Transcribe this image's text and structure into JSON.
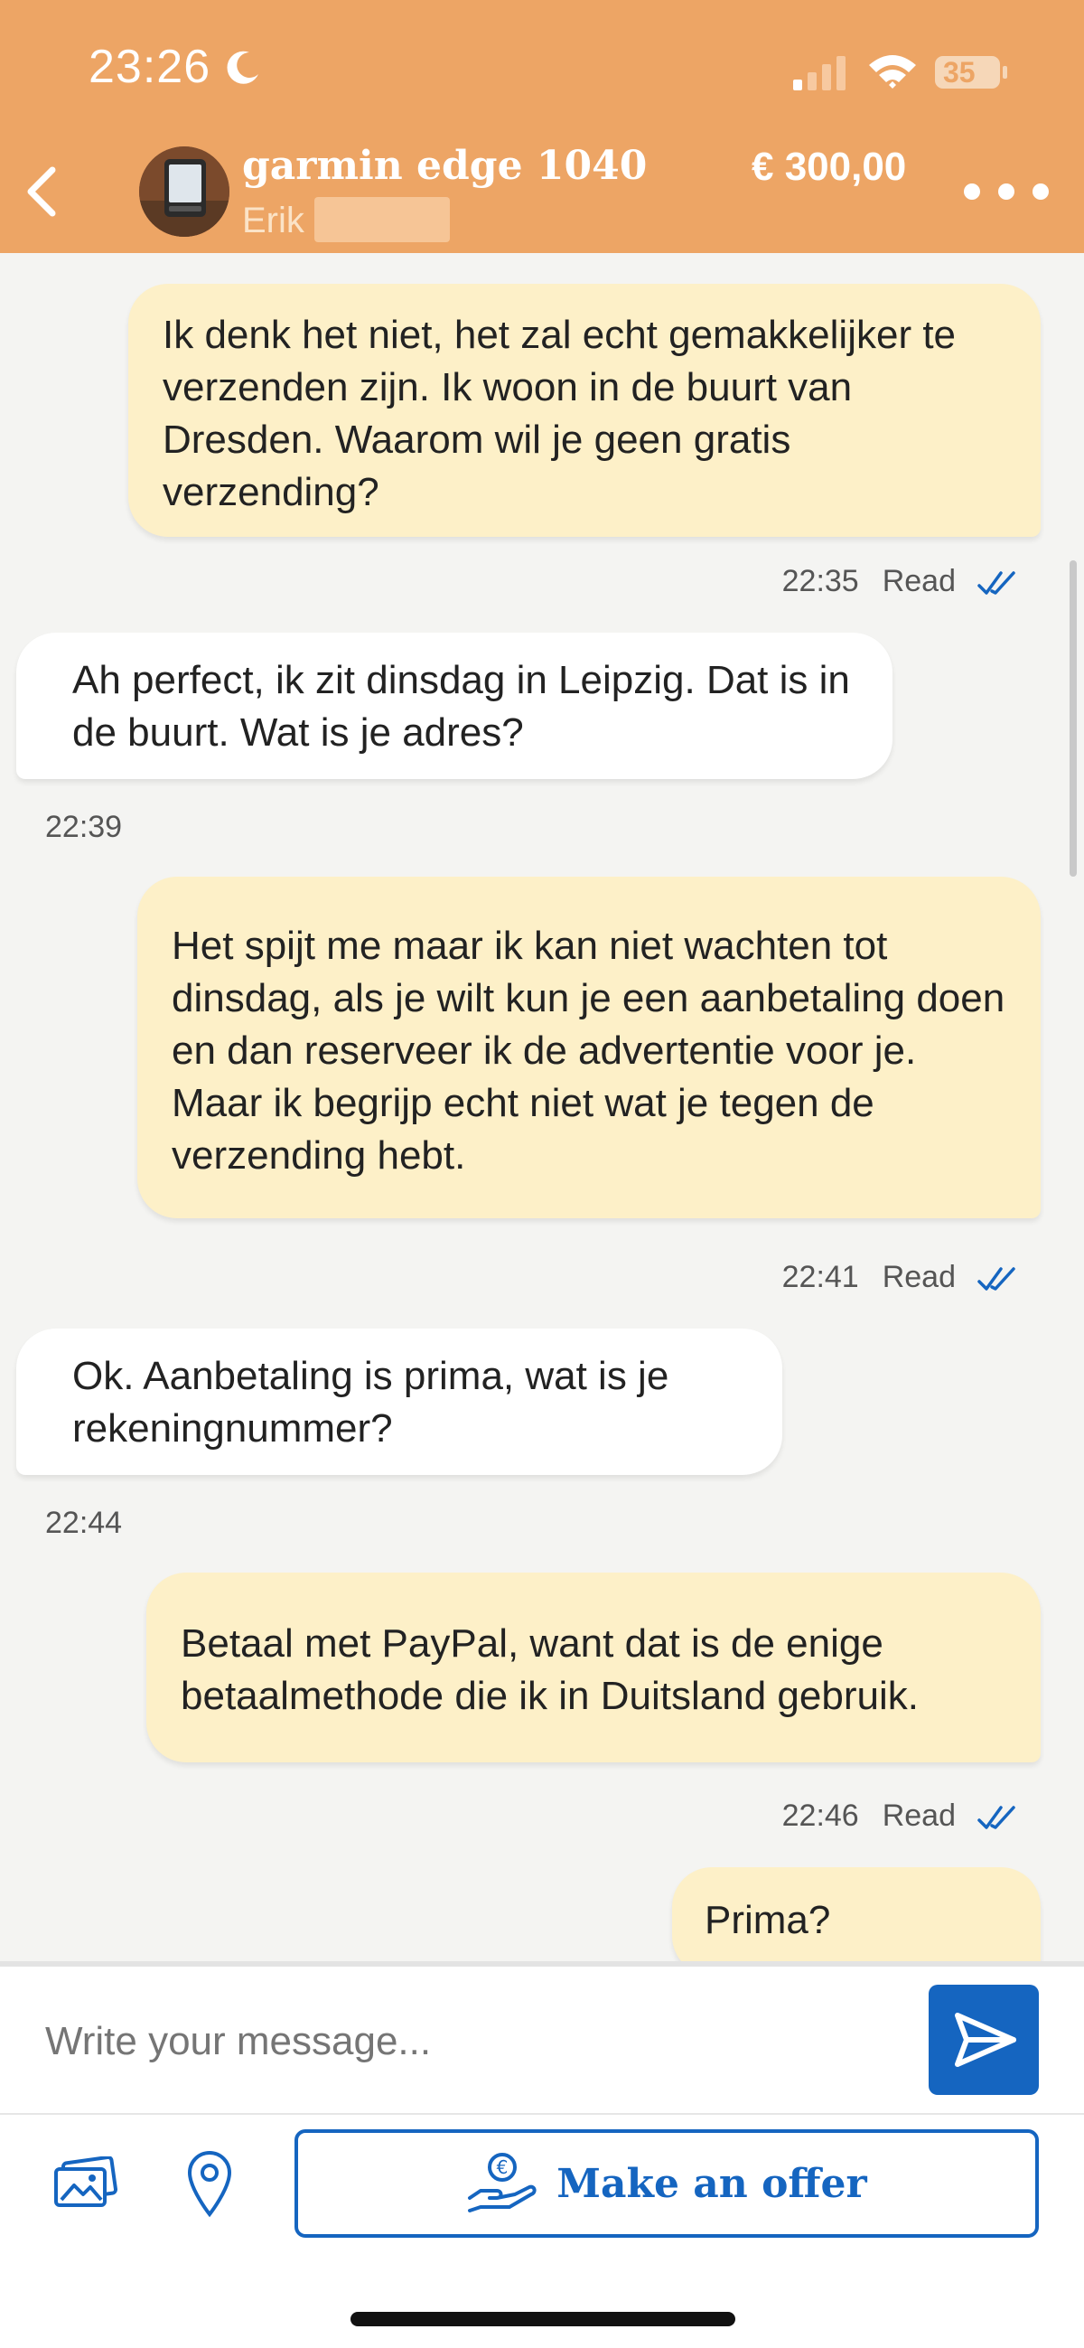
{
  "status_bar": {
    "time": "23:26",
    "battery": "35"
  },
  "header": {
    "title": "garmin edge 1040",
    "seller": "Erik",
    "price": "€ 300,00"
  },
  "messages": [
    {
      "id": "m1",
      "type": "sent",
      "text": "Ik denk het niet, het zal echt gemakkelijker te verzenden zijn. Ik woon in de buurt van Dresden. Waarom wil je geen gratis verzending?",
      "time": "22:35",
      "status": "Read"
    },
    {
      "id": "m2",
      "type": "received",
      "text": "Ah perfect, ik zit dinsdag in Leipzig. Dat is in de buurt. Wat is je adres?",
      "time": "22:39"
    },
    {
      "id": "m3",
      "type": "sent",
      "text": "Het spijt me maar ik kan niet wachten tot dinsdag, als je wilt kun je een aanbetaling doen en dan reserveer ik de advertentie voor je. Maar ik begrijp echt niet wat je tegen de verzending hebt.",
      "time": "22:41",
      "status": "Read"
    },
    {
      "id": "m4",
      "type": "received",
      "text": "Ok. Aanbetaling is prima, wat is je rekeningnummer?",
      "time": "22:44"
    },
    {
      "id": "m5",
      "type": "sent",
      "text": "Betaal met PayPal, want dat is de enige betaalmethode die ik in Duitsland gebruik.",
      "time": "22:46",
      "status": "Read"
    },
    {
      "id": "m6",
      "type": "sent",
      "text": "Prima?"
    }
  ],
  "composer": {
    "placeholder": "Write your message..."
  },
  "toolbar": {
    "offer_label": "Make an offer"
  },
  "colors": {
    "header": "#eda565",
    "sent_bubble": "#fdf0c8",
    "received_bubble": "#ffffff",
    "accent": "#1565c0"
  },
  "icons": [
    "moon-icon",
    "signal-icon",
    "wifi-icon",
    "battery-icon",
    "back-arrow-icon",
    "more-icon",
    "double-check-icon",
    "send-icon",
    "photo-icon",
    "location-pin-icon",
    "euro-hand-icon"
  ]
}
